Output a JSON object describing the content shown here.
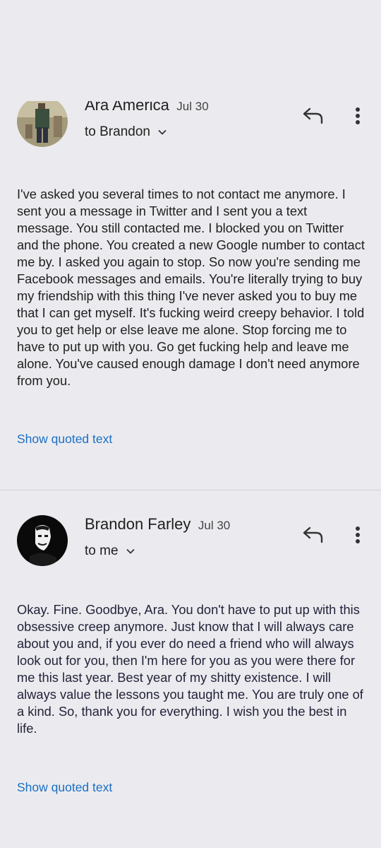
{
  "messages": [
    {
      "sender": "Ara America",
      "date": "Jul 30",
      "recipient": "to Brandon",
      "body": "I've asked you several times to not contact me anymore. I sent you a message in Twitter and I sent you a text message. You still contacted me. I blocked you on Twitter and the phone. You created a new Google number to contact me by. I asked you again to stop. So now you're sending me Facebook messages and emails. You're literally trying to buy my friendship with this thing I've never asked you to buy me that I can get myself. It's fucking weird creepy behavior. I told you to get help or else leave me alone. Stop forcing me to have to put up with you. Go get fucking help and leave me alone. You've caused enough damage I don't need anymore from you.",
      "show_quoted": "Show quoted text"
    },
    {
      "sender": "Brandon Farley",
      "date": "Jul 30",
      "recipient": "to me",
      "body": "Okay. Fine. Goodbye, Ara. You don't have to put up with this obsessive creep anymore. Just know that I will always care about you and, if you ever do need a friend who will always look out for you, then I'm here for you as you were there for me this last year. Best year of my shitty existence. I will always value the lessons you taught me. You are truly one of a kind. So, thank you for everything. I wish you the best in life.",
      "show_quoted": "Show quoted text"
    }
  ],
  "icons": {
    "reply": "reply-icon",
    "more": "more-vert-icon",
    "expand": "chevron-down-icon"
  },
  "colors": {
    "background": "#ebebef",
    "link": "#1a6fc4",
    "divider": "#d2d2d8"
  }
}
